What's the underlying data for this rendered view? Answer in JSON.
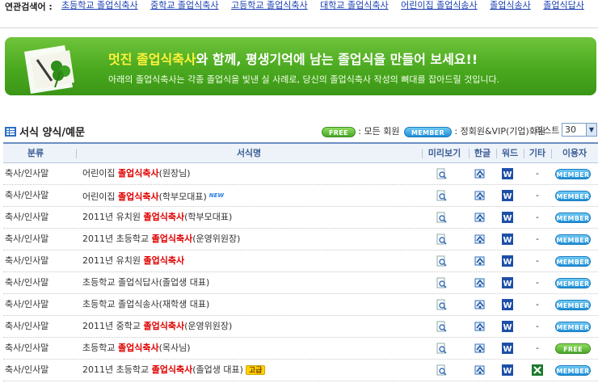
{
  "related_search": {
    "label": "연관검색어 :",
    "links": [
      "초등학교 졸업식축사",
      "중학교 졸업식축사",
      "고등학교 졸업식축사",
      "대학교 졸업식축사",
      "어린이집 졸업식송사",
      "졸업식송사",
      "졸업식답사"
    ]
  },
  "banner": {
    "headline_highlight": "멋진 졸업식축사",
    "headline_rest": "와 함께, 평생기억에 남는 졸업식을 만들어 보세요!!",
    "subtitle": "아래의 졸업식축사는 각종 졸업식을 빛낸 실 사례로, 당신의 졸업식축사 작성의 뼈대를 잡아드릴 것입니다."
  },
  "section": {
    "title": "서식 양식/예문",
    "legend_free_badge": "FREE",
    "legend_free_text": ": 모든 회원",
    "legend_member_badge": "MEMBER",
    "legend_member_text": ": 정회원&VIP(기업)회원",
    "list_label": "리스트 :",
    "list_value": "30"
  },
  "table": {
    "headers": {
      "category": "분류",
      "title": "서식명",
      "preview": "미리보기",
      "hwp": "한글",
      "word": "워드",
      "etc": "기타",
      "user": "이용자"
    },
    "rows": [
      {
        "category": "축사/인사말",
        "pre": "어린이집 ",
        "kw": "졸업식축사",
        "post": "(원장님)",
        "badge": "",
        "etc": "-",
        "user": "MEMBER",
        "excel": false
      },
      {
        "category": "축사/인사말",
        "pre": "어린이집 ",
        "kw": "졸업식축사",
        "post": "(학부모대표)",
        "badge": "NEW",
        "etc": "-",
        "user": "MEMBER",
        "excel": false
      },
      {
        "category": "축사/인사말",
        "pre": "2011년 유치원 ",
        "kw": "졸업식축사",
        "post": "(학부모대표)",
        "badge": "",
        "etc": "-",
        "user": "MEMBER",
        "excel": false
      },
      {
        "category": "축사/인사말",
        "pre": "2011년 초등학교 ",
        "kw": "졸업식축사",
        "post": "(운영위원장)",
        "badge": "",
        "etc": "-",
        "user": "MEMBER",
        "excel": false
      },
      {
        "category": "축사/인사말",
        "pre": "2011년 유치원 ",
        "kw": "졸업식축사",
        "post": "",
        "badge": "",
        "etc": "-",
        "user": "MEMBER",
        "excel": false
      },
      {
        "category": "축사/인사말",
        "pre": "초등학교 졸업식답사(졸업생 대표)",
        "kw": "",
        "post": "",
        "badge": "",
        "etc": "-",
        "user": "MEMBER",
        "excel": false
      },
      {
        "category": "축사/인사말",
        "pre": "초등학교 졸업식송사(재학생 대표)",
        "kw": "",
        "post": "",
        "badge": "",
        "etc": "-",
        "user": "MEMBER",
        "excel": false
      },
      {
        "category": "축사/인사말",
        "pre": "2011년 중학교 ",
        "kw": "졸업식축사",
        "post": "(운영위원장)",
        "badge": "",
        "etc": "-",
        "user": "MEMBER",
        "excel": false
      },
      {
        "category": "축사/인사말",
        "pre": "초등학교 ",
        "kw": "졸업식축사",
        "post": "(목사님)",
        "badge": "",
        "etc": "-",
        "user": "FREE",
        "excel": false
      },
      {
        "category": "축사/인사말",
        "pre": "2011년 초등학교 ",
        "kw": "졸업식축사",
        "post": "(졸업생 대표)",
        "badge": "고급",
        "etc": "",
        "user": "MEMBER",
        "excel": true
      }
    ]
  },
  "colors": {
    "banner_green": "#4aa91f",
    "highlight_yellow": "#fff23a",
    "keyword_red": "#e00000",
    "member_blue": "#1f8fd8",
    "free_green": "#4aa82b",
    "link_blue": "#1a3fb0"
  }
}
